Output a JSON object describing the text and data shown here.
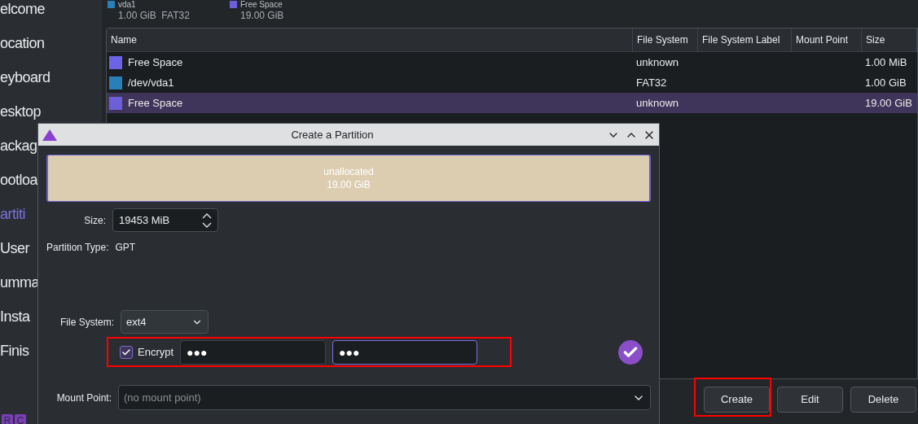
{
  "sidebar": {
    "items": [
      {
        "label": "elcome",
        "selected": false
      },
      {
        "label": "ocation",
        "selected": false
      },
      {
        "label": "eyboard",
        "selected": false
      },
      {
        "label": "esktop",
        "selected": false
      },
      {
        "label": "ackag",
        "selected": false
      },
      {
        "label": "ootloa",
        "selected": false
      },
      {
        "label": "artiti",
        "selected": true
      },
      {
        "label": "User",
        "selected": false
      },
      {
        "label": "umma",
        "selected": false
      },
      {
        "label": "Insta",
        "selected": false
      },
      {
        "label": "Finis",
        "selected": false
      }
    ],
    "badges": [
      "R",
      "C"
    ]
  },
  "legend": [
    {
      "name": "vda1",
      "detail": "1.00 GiB  FAT32",
      "color": "#2980b9"
    },
    {
      "name": "Free Space",
      "detail": "19.00 GiB",
      "color": "#6c5fd8"
    }
  ],
  "table": {
    "columns": [
      "Name",
      "File System",
      "File System Label",
      "Mount Point",
      "Size"
    ],
    "rows": [
      {
        "name": "Free Space",
        "file_system": "unknown",
        "size": "1.00 MiB",
        "color": "#6c63e6",
        "selected": false
      },
      {
        "name": "/dev/vda1",
        "file_system": "FAT32",
        "size": "1.00 GiB",
        "color": "#2980b9",
        "selected": false
      },
      {
        "name": "Free Space",
        "file_system": "unknown",
        "size": "19.00 GiB",
        "color": "#6c5fd8",
        "selected": true
      }
    ]
  },
  "buttons": [
    "Create",
    "Edit",
    "Delete"
  ],
  "dialog": {
    "title": "Create a Partition",
    "bar": {
      "label": "unallocated",
      "size": "19.00 GiB"
    },
    "size": {
      "label": "Size:",
      "value": "19453 MiB"
    },
    "partition_type": {
      "label": "Partition Type:",
      "value": "GPT"
    },
    "file_system": {
      "label": "File System:",
      "value": "ext4"
    },
    "encrypt": {
      "label": "Encrypt",
      "checked": true,
      "passphrase": "●●●",
      "confirm": "●●●",
      "match": true
    },
    "mount_point": {
      "label": "Mount Point:",
      "placeholder": "(no mount point)"
    }
  }
}
